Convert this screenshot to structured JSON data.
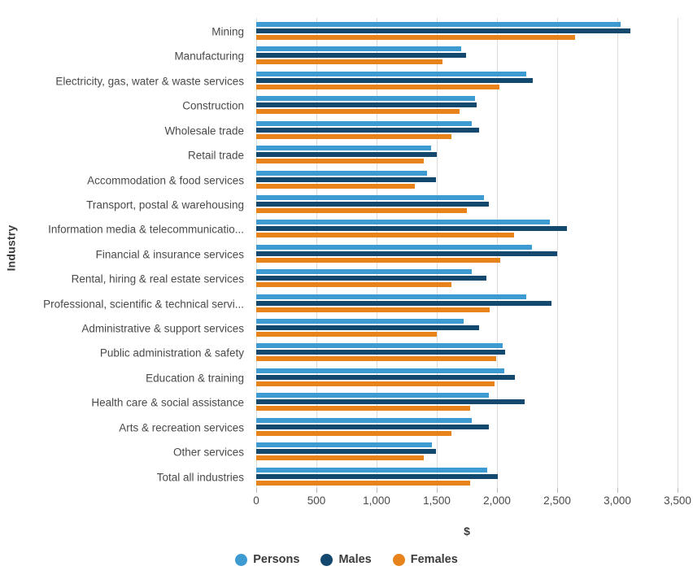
{
  "axes": {
    "y_title": "Industry",
    "x_title": "$",
    "x_ticks": [
      "0",
      "500",
      "1,000",
      "1,500",
      "2,000",
      "2,500",
      "3,000",
      "3,500"
    ]
  },
  "legend": {
    "items": [
      {
        "label": "Persons",
        "color": "#3d9bd1"
      },
      {
        "label": "Males",
        "color": "#13496f"
      },
      {
        "label": "Females",
        "color": "#e8821a"
      }
    ]
  },
  "chart_data": {
    "type": "bar",
    "orientation": "horizontal",
    "title": "",
    "xlabel": "$",
    "ylabel": "Industry",
    "xlim": [
      0,
      3500
    ],
    "xticks": [
      0,
      500,
      1000,
      1500,
      2000,
      2500,
      3000,
      3500
    ],
    "grid": "vertical",
    "legend_position": "bottom",
    "categories": [
      "Mining",
      "Manufacturing",
      "Electricity, gas, water & waste services",
      "Construction",
      "Wholesale trade",
      "Retail trade",
      "Accommodation & food services",
      "Transport, postal & warehousing",
      "Information media & telecommunicatio...",
      "Financial & insurance services",
      "Rental, hiring & real estate services",
      "Professional, scientific & technical servi...",
      "Administrative & support services",
      "Public administration & safety",
      "Education & training",
      "Health care & social assistance",
      "Arts & recreation services",
      "Other services",
      "Total all industries"
    ],
    "series": [
      {
        "name": "Persons",
        "color": "#3d9bd1",
        "values": [
          3030,
          1700,
          2245,
          1820,
          1790,
          1450,
          1420,
          1890,
          2440,
          2290,
          1790,
          2240,
          1720,
          2050,
          2060,
          1930,
          1790,
          1460,
          1920
        ]
      },
      {
        "name": "Males",
        "color": "#13496f",
        "values": [
          3110,
          1740,
          2300,
          1830,
          1850,
          1500,
          1490,
          1930,
          2580,
          2500,
          1910,
          2450,
          1850,
          2070,
          2150,
          2230,
          1930,
          1490,
          2010
        ]
      },
      {
        "name": "Females",
        "color": "#e8821a",
        "values": [
          2650,
          1550,
          2020,
          1690,
          1620,
          1390,
          1320,
          1750,
          2140,
          2030,
          1620,
          1940,
          1500,
          1990,
          1980,
          1780,
          1620,
          1390,
          1780
        ]
      }
    ]
  }
}
